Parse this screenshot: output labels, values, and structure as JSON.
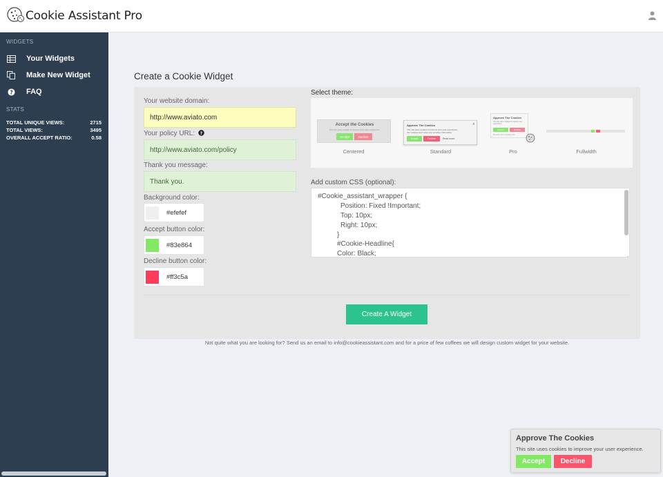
{
  "app": {
    "title": "Cookie Assistant Pro",
    "logo_icon": "cookie-icon",
    "user_icon": "user-icon"
  },
  "sidebar": {
    "widgets_title": "WIDGETS",
    "items": [
      {
        "label": "Your Widgets",
        "icon": "table-icon"
      },
      {
        "label": "Make New Widget",
        "icon": "copy-icon"
      },
      {
        "label": "FAQ",
        "icon": "question-circle-icon"
      }
    ],
    "stats_title": "STATS",
    "stats": [
      {
        "label": "TOTAL UNIQUE VIEWS:",
        "value": "2715"
      },
      {
        "label": "TOTAL VIEWS:",
        "value": "3495"
      },
      {
        "label": "OVERALL ACCEPT RATIO:",
        "value": "0.58"
      }
    ]
  },
  "main": {
    "page_title": "Create a Cookie Widget",
    "form": {
      "domain_label": "Your website domain:",
      "domain_value": "http://www.aviato.com",
      "policy_label": "Your policy URL:",
      "policy_value": "http://www.aviato.com/policy",
      "thanks_label": "Thank you message:",
      "thanks_value": "Thank you.",
      "bg_label": "Background color:",
      "bg_value": "#efefef",
      "accept_label": "Accept button color:",
      "accept_value": "#83e864",
      "decline_label": "Decline button color:",
      "decline_value": "#ff3c5a"
    },
    "theme_label": "Select theme:",
    "themes": {
      "centered": {
        "name": "Centered",
        "title": "Accept the Cookies",
        "text": "This site uses cookies to improve your user experience.",
        "accept": "Accept",
        "decline": "Decline"
      },
      "standard": {
        "name": "Standard",
        "title": "Approve The Cookies",
        "text1": "This site uses cookies to improve your user experience.",
        "text2": "Our cookies won't store any sensitive information.",
        "accept": "Accept",
        "decline": "Decline",
        "read_more": "Read more.",
        "close": "x"
      },
      "pro": {
        "name": "Pro",
        "title": "Approve The Cookies",
        "text": "This site uses cookies to improve your experience.",
        "accept": "Accept",
        "decline": "Decline",
        "footer": "We won't store sensitive info."
      },
      "fullwidth": {
        "name": "Fullwidth"
      }
    },
    "css_label": "Add custom CSS (optional):",
    "css_lines": [
      "#Cookie_assistant_wrapper {",
      "Position: Fixed !Important;",
      "Top: 10px;",
      "Right: 10px;",
      "}",
      "#Cookie-Headline{",
      "Color: Black;"
    ],
    "create_button": "Create A Widget",
    "footnote": "Not quite what you are looking for? Send us an email to info@cookieassistant.com and for a price of few coffees we will design custom widget for your website."
  },
  "cookie_popup": {
    "title": "Approve The Cookies",
    "text": "This site uses cookies to improve your user experience.",
    "accept": "Accept",
    "decline": "Decline"
  },
  "colors": {
    "sidebar_bg": "#2c3e50",
    "accent_green": "#2cc38f",
    "accept": "#83e864",
    "decline": "#ff3c5a",
    "background_swatch": "#efefef"
  }
}
